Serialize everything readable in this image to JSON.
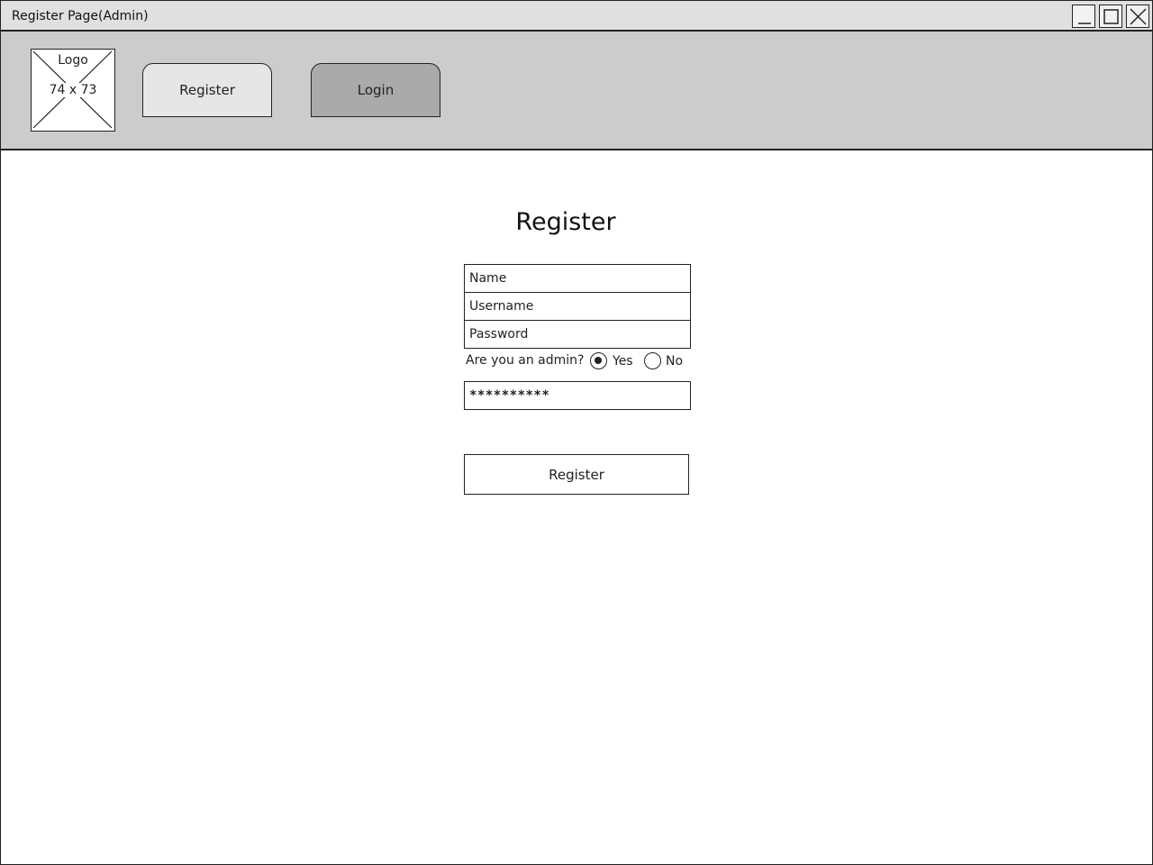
{
  "window": {
    "title": "Register Page(Admin)",
    "controls": [
      "minimize-icon",
      "maximize-icon",
      "close-icon"
    ]
  },
  "header": {
    "logo": {
      "label": "Logo",
      "size_text": "74 x 73"
    },
    "nav": [
      {
        "label": "Register",
        "active": false
      },
      {
        "label": "Login",
        "active": true
      }
    ]
  },
  "form": {
    "title": "Register",
    "fields": {
      "name_placeholder": "Name",
      "username_placeholder": "Username",
      "password_placeholder": "Password"
    },
    "admin_question": "Are you an admin?",
    "admin_options": [
      {
        "label": "Yes",
        "selected": true
      },
      {
        "label": "No",
        "selected": false
      }
    ],
    "admin_password_value": "**********",
    "submit_label": "Register"
  },
  "colors": {
    "titlebar": "#e0e0e0",
    "header_band": "#cccccc",
    "nav_register_bg": "#e6e6e6",
    "nav_login_bg": "#aaaaaa"
  }
}
